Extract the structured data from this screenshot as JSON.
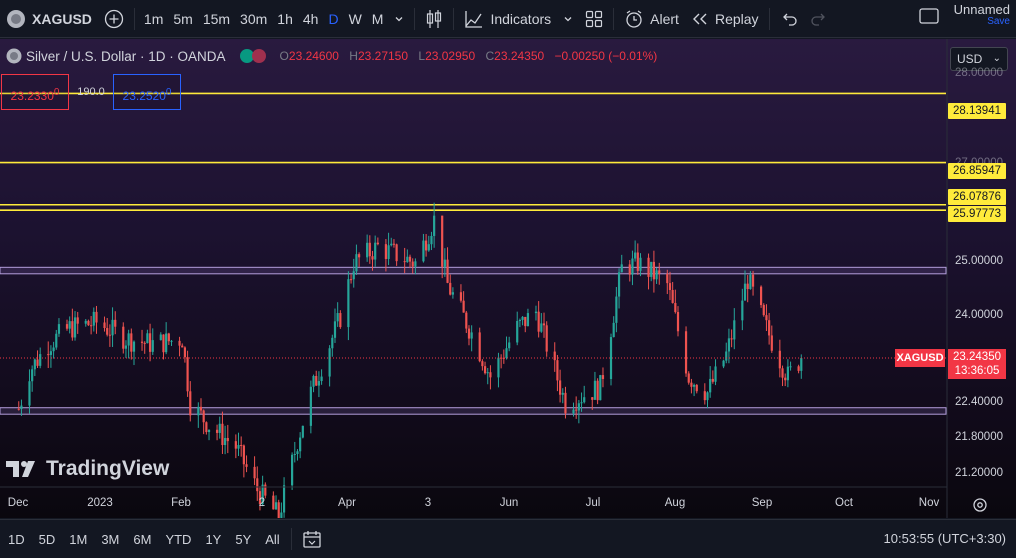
{
  "toolbar": {
    "symbol": "XAGUSD",
    "intervals": [
      "1m",
      "5m",
      "15m",
      "30m",
      "1h",
      "4h",
      "D",
      "W",
      "M"
    ],
    "active_interval": "D",
    "indicators_label": "Indicators",
    "alert_label": "Alert",
    "replay_label": "Replay",
    "layout_name": "Unnamed",
    "layout_save": "Save"
  },
  "legend": {
    "title": "Silver / U.S. Dollar · 1D · OANDA",
    "open_label": "O",
    "open": "23.24600",
    "high_label": "H",
    "high": "23.27150",
    "low_label": "L",
    "low": "23.02950",
    "close_label": "C",
    "close": "23.24350",
    "change": "−0.00250 (−0.01%)"
  },
  "trade": {
    "sell_price": "23.2330",
    "sell_sup": "0",
    "spread": "190.0",
    "buy_price": "23.2520",
    "buy_sup": "0"
  },
  "currency": "USD",
  "y_axis": {
    "ticks": [
      "25.00000",
      "24.00000",
      "22.40000",
      "21.80000",
      "21.20000"
    ],
    "hidden_ticks": [
      "27.00000",
      "28.00000"
    ]
  },
  "levels": [
    "28.13941",
    "26.85947",
    "26.07876",
    "25.97773"
  ],
  "current": {
    "symbol": "XAGUSD",
    "price": "23.24350",
    "countdown": "13:36:05"
  },
  "x_axis": {
    "ticks": [
      "Dec",
      "2023",
      "Feb",
      "2",
      "Apr",
      "3",
      "Jun",
      "Jul",
      "Aug",
      "Sep",
      "Oct",
      "Nov"
    ]
  },
  "watermark": "TradingView",
  "bottom": {
    "ranges": [
      "1D",
      "5D",
      "1M",
      "3M",
      "6M",
      "YTD",
      "1Y",
      "5Y",
      "All"
    ],
    "time": "10:53:55 (UTC+3:30)"
  },
  "colors": {
    "up": "#26a69a",
    "down": "#ef5350",
    "level": "#ffeb3b",
    "accent": "#2962ff"
  },
  "chart_data": {
    "type": "candlestick",
    "symbol": "XAGUSD",
    "interval": "1D",
    "anchors": [
      {
        "date": "2022-12-01",
        "close": 22.3
      },
      {
        "date": "2022-12-05",
        "close": 23.0
      },
      {
        "date": "2022-12-12",
        "close": 23.5
      },
      {
        "date": "2022-12-20",
        "close": 23.8
      },
      {
        "date": "2022-12-30",
        "close": 23.9
      },
      {
        "date": "2023-01-10",
        "close": 23.6
      },
      {
        "date": "2023-01-20",
        "close": 23.5
      },
      {
        "date": "2023-01-31",
        "close": 23.6
      },
      {
        "date": "2023-02-03",
        "close": 22.4
      },
      {
        "date": "2023-02-10",
        "close": 22.0
      },
      {
        "date": "2023-02-20",
        "close": 21.6
      },
      {
        "date": "2023-02-28",
        "close": 20.8
      },
      {
        "date": "2023-03-08",
        "close": 20.3
      },
      {
        "date": "2023-03-15",
        "close": 21.7
      },
      {
        "date": "2023-03-20",
        "close": 22.6
      },
      {
        "date": "2023-03-31",
        "close": 24.0
      },
      {
        "date": "2023-04-05",
        "close": 25.0
      },
      {
        "date": "2023-04-14",
        "close": 25.3
      },
      {
        "date": "2023-04-28",
        "close": 25.0
      },
      {
        "date": "2023-05-05",
        "close": 25.8
      },
      {
        "date": "2023-05-10",
        "close": 24.6
      },
      {
        "date": "2023-05-20",
        "close": 23.6
      },
      {
        "date": "2023-05-26",
        "close": 22.9
      },
      {
        "date": "2023-06-05",
        "close": 23.8
      },
      {
        "date": "2023-06-12",
        "close": 24.1
      },
      {
        "date": "2023-06-23",
        "close": 22.4
      },
      {
        "date": "2023-07-06",
        "close": 22.7
      },
      {
        "date": "2023-07-14",
        "close": 24.9
      },
      {
        "date": "2023-07-20",
        "close": 25.0
      },
      {
        "date": "2023-07-31",
        "close": 24.6
      },
      {
        "date": "2023-08-08",
        "close": 22.9
      },
      {
        "date": "2023-08-15",
        "close": 22.6
      },
      {
        "date": "2023-08-22",
        "close": 23.3
      },
      {
        "date": "2023-08-30",
        "close": 24.7
      },
      {
        "date": "2023-09-05",
        "close": 23.9
      },
      {
        "date": "2023-09-12",
        "close": 23.1
      },
      {
        "date": "2023-09-14",
        "close": 22.9
      },
      {
        "date": "2023-09-19",
        "close": 23.24
      }
    ],
    "support_zone": [
      22.2,
      22.32
    ],
    "resistance_zone": [
      24.8,
      24.92
    ],
    "horizontal_levels": [
      28.13941,
      26.85947,
      26.07876,
      25.97773
    ],
    "ylim": [
      20.6,
      28.9
    ],
    "xlim": [
      "2022-11-24",
      "2023-11-12"
    ]
  }
}
